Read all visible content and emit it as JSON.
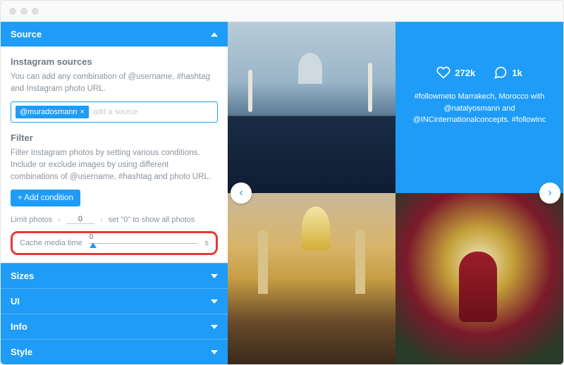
{
  "panels": {
    "source": "Source",
    "sizes": "Sizes",
    "ui": "UI",
    "info": "Info",
    "style": "Style"
  },
  "sources": {
    "heading": "Instagram sources",
    "hint": "You can add any combination of @username, #hashtag and Instagram photo URL.",
    "tag": "@muradosmann",
    "placeholder": "add a source"
  },
  "filter": {
    "heading": "Filter",
    "hint": "Filter Instagram photos by setting various conditions. Include or exclude images by using different combinations of @username, #hashtag and photo URL.",
    "add_condition": "+  Add condition",
    "limit_label": "Limit photos",
    "limit_value": "0",
    "limit_hint": "set \"0\" to show all photos",
    "cache_label": "Cache media time",
    "cache_value": "0",
    "cache_unit": "s"
  },
  "preview": {
    "likes": "272k",
    "comments": "1k",
    "caption": "#followmeto Marrakech, Morocco with @natalyosmann and @INCinternationalconcepts. #followinc"
  },
  "colors": {
    "accent": "#1e9cf7",
    "highlight": "#e53935"
  }
}
